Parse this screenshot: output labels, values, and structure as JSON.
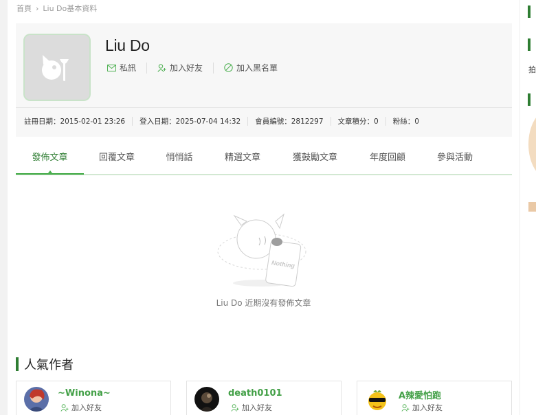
{
  "breadcrumb": {
    "home": "首頁",
    "separator": "›",
    "current": "Liu Do基本資料"
  },
  "profile": {
    "username": "Liu Do",
    "actions": {
      "message": "私訊",
      "add_friend": "加入好友",
      "blacklist": "加入黑名單"
    },
    "stats": {
      "register": "註冊日期：2015-02-01 23:26",
      "login": "登入日期：2025-07-04 14:32",
      "member_no": "會員編號：2812297",
      "points": "文章積分：0",
      "fans": "粉絲：0"
    }
  },
  "tabs": [
    {
      "label": "發佈文章",
      "active": true
    },
    {
      "label": "回覆文章"
    },
    {
      "label": "悄悄話"
    },
    {
      "label": "精選文章"
    },
    {
      "label": "獲鼓勵文章"
    },
    {
      "label": "年度回顧"
    },
    {
      "label": "參與活動"
    }
  ],
  "empty": {
    "illustration_text": "Nothing",
    "message": "Liu Do 近期沒有發佈文章"
  },
  "popular": {
    "title": "人氣作者",
    "authors": [
      {
        "name": "~Winona~",
        "action": "加入好友"
      },
      {
        "name": "death0101",
        "action": "加入好友"
      },
      {
        "name": "A辣愛怕跑",
        "action": "加入好友"
      }
    ]
  },
  "right_sidebar": {
    "snippet": "拍"
  },
  "colors": {
    "accent": "#2e7d32",
    "accent_light": "#4caf50",
    "name_green": "#43a047"
  }
}
